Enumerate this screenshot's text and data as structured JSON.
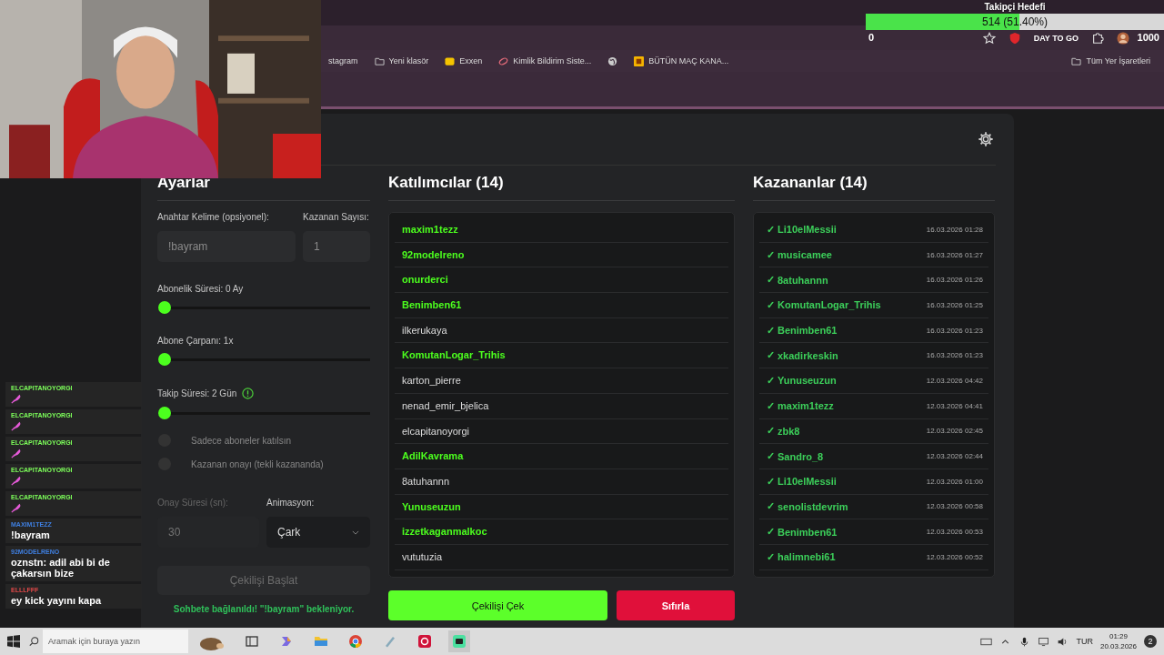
{
  "browser": {
    "bookmarks": [
      {
        "label": "stagram",
        "kind": "plain"
      },
      {
        "label": "Yeni klasör",
        "kind": "folder"
      },
      {
        "label": "Exxen",
        "kind": "badge"
      },
      {
        "label": "Kimlik Bildirim Siste...",
        "kind": "leaf"
      },
      {
        "kind": "globe"
      },
      {
        "label": "BÜTÜN MAÇ KANA...",
        "kind": "square"
      }
    ],
    "all_bookmarks": "Tüm Yer İşaretleri",
    "extension_badge": "DAY TO GO"
  },
  "follower_goal": {
    "title": "Takipçi Hedefi",
    "reading": "514 (51.40%)",
    "level": 0.514,
    "min": "0",
    "max": "1000"
  },
  "settings": {
    "title": "Ayarlar",
    "keyword": {
      "label": "Anahtar Kelime (opsiyonel):",
      "placeholder": "!bayram"
    },
    "winner_count": {
      "label": "Kazanan Sayısı:",
      "placeholder": "1"
    },
    "sliders": [
      {
        "label": "Abonelik Süresi: 0 Ay",
        "level": 0,
        "info": false
      },
      {
        "label": "Abone Çarpanı: 1x",
        "level": 0,
        "info": false
      },
      {
        "label": "Takip Süresi:  2  Gün",
        "level": 0,
        "info": true
      }
    ],
    "toggles": [
      {
        "label": "Sadece aboneler katılsın",
        "on": false
      },
      {
        "label": "Kazanan onayı (tekli kazananda)",
        "on": false
      }
    ],
    "approval_time": {
      "label": "Onay Süresi (sn):",
      "placeholder": "30",
      "disabled": true
    },
    "animation": {
      "label": "Animasyon:",
      "value": "Çark"
    },
    "start_button": {
      "label": "Çekilişi Başlat",
      "disabled": true
    },
    "status": "Sohbete bağlanıldı! \"!bayram\" bekleniyor."
  },
  "participants": {
    "title": "Katılımcılar (14)",
    "items": [
      {
        "name": "maxim1tezz",
        "highlighted": true
      },
      {
        "name": "92modelreno",
        "highlighted": true
      },
      {
        "name": "onurderci",
        "highlighted": true
      },
      {
        "name": "Benimben61",
        "highlighted": true
      },
      {
        "name": "ilkerukaya",
        "highlighted": false
      },
      {
        "name": "KomutanLogar_Trihis",
        "highlighted": true
      },
      {
        "name": "karton_pierre",
        "highlighted": false
      },
      {
        "name": "nenad_emir_bjelica",
        "highlighted": false
      },
      {
        "name": "elcapitanoyorgi",
        "highlighted": false
      },
      {
        "name": "AdilKavrama",
        "highlighted": true
      },
      {
        "name": "8atuhannn",
        "highlighted": false
      },
      {
        "name": "Yunuseuzun",
        "highlighted": true
      },
      {
        "name": "izzetkaganmalkoc",
        "highlighted": true
      },
      {
        "name": "vututuzia",
        "highlighted": false
      }
    ]
  },
  "winners": {
    "title": "Kazananlar (14)",
    "items": [
      {
        "check": "✓",
        "name": "Li10elMessii",
        "time": "16.03.2026 01:28"
      },
      {
        "check": "✓",
        "name": "musicamee",
        "time": "16.03.2026 01:27"
      },
      {
        "check": "✓",
        "name": "8atuhannn",
        "time": "16.03.2026 01:26"
      },
      {
        "check": "✓",
        "name": "KomutanLogar_Trihis",
        "time": "16.03.2026 01:25"
      },
      {
        "check": "✓",
        "name": "Benimben61",
        "time": "16.03.2026 01:23"
      },
      {
        "check": "✓",
        "name": "xkadirkeskin",
        "time": "16.03.2026 01:23"
      },
      {
        "check": "✓",
        "name": "Yunuseuzun",
        "time": "12.03.2026 04:42"
      },
      {
        "check": "✓",
        "name": "maxim1tezz",
        "time": "12.03.2026 04:41"
      },
      {
        "check": "✓",
        "name": "zbk8",
        "time": "12.03.2026 02:45"
      },
      {
        "check": "✓",
        "name": "Sandro_8",
        "time": "12.03.2026 02:44"
      },
      {
        "check": "✓",
        "name": "Li10elMessii",
        "time": "12.03.2026 01:00"
      },
      {
        "check": "✓",
        "name": "senolistdevrim",
        "time": "12.03.2026 00:58"
      },
      {
        "check": "✓",
        "name": "Benimben61",
        "time": "12.03.2026 00:53"
      },
      {
        "check": "✓",
        "name": "halimnebi61",
        "time": "12.03.2026 00:52"
      }
    ]
  },
  "actions": [
    {
      "label": "Çekilişi Çek",
      "kind": "draw"
    },
    {
      "label": "Sıfırla",
      "kind": "reset"
    }
  ],
  "chat": [
    {
      "user": "ELCAPITANOYORGI",
      "color": "#7dff5a",
      "kind": "emote"
    },
    {
      "user": "ELCAPITANOYORGI",
      "color": "#7dff5a",
      "kind": "emote"
    },
    {
      "user": "ELCAPITANOYORGI",
      "color": "#7dff5a",
      "kind": "emote"
    },
    {
      "user": "ELCAPITANOYORGI",
      "color": "#7dff5a",
      "kind": "emote"
    },
    {
      "user": "ELCAPITANOYORGI",
      "color": "#7dff5a",
      "kind": "emote"
    },
    {
      "user": "MAXIM1TEZZ",
      "color": "#3f7fe0",
      "kind": "text",
      "text": "!bayram"
    },
    {
      "user": "92MODELRENO",
      "color": "#3f7fe0",
      "kind": "text",
      "text": "oznstn: adil abi bi de çakarsın bize"
    },
    {
      "user": "ELLLFFF",
      "color": "#e04848",
      "kind": "text",
      "text": "ey kick yayını kapa"
    }
  ],
  "taskbar": {
    "search_placeholder": "Aramak için buraya yazın",
    "language": "TUR",
    "time": "01:29",
    "date": "20.03.2026",
    "notifications": "2"
  }
}
